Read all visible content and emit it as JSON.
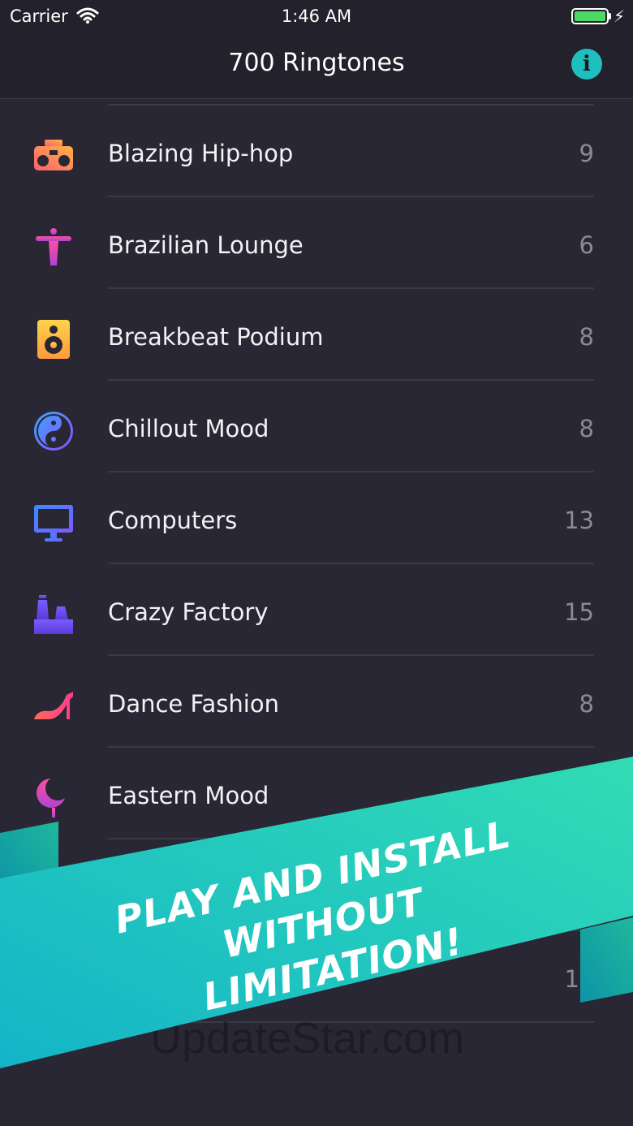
{
  "status_bar": {
    "carrier": "Carrier",
    "time": "1:46 AM",
    "wifi_icon": "wifi-icon",
    "battery_icon": "battery-icon",
    "charging_icon": "bolt-icon"
  },
  "nav": {
    "title": "700 Ringtones",
    "info_label": "i",
    "info_icon": "info-icon"
  },
  "categories": [
    {
      "label": "Blazing Hip-hop",
      "count": "9",
      "icon": "boombox-icon",
      "colors": [
        "#ff5f6d",
        "#ffb347"
      ]
    },
    {
      "label": "Brazilian Lounge",
      "count": "6",
      "icon": "christ-statue-icon",
      "colors": [
        "#ff4fa3",
        "#b043d1"
      ]
    },
    {
      "label": "Breakbeat Podium",
      "count": "8",
      "icon": "speaker-icon",
      "colors": [
        "#ffd24c",
        "#ff9a3c"
      ]
    },
    {
      "label": "Chillout Mood",
      "count": "8",
      "icon": "yin-yang-icon",
      "colors": [
        "#3ba6ff",
        "#8a4dff"
      ]
    },
    {
      "label": "Computers",
      "count": "13",
      "icon": "monitor-icon",
      "colors": [
        "#3b8bff",
        "#7a5cff"
      ]
    },
    {
      "label": "Crazy Factory",
      "count": "15",
      "icon": "factory-icon",
      "colors": [
        "#7b5cff",
        "#5a3bd6"
      ]
    },
    {
      "label": "Dance Fashion",
      "count": "8",
      "icon": "high-heel-icon",
      "colors": [
        "#ff6a5c",
        "#ff3d8b"
      ]
    },
    {
      "label": "Eastern Mood",
      "count": "",
      "icon": "crescent-icon",
      "colors": [
        "#ff4fa3",
        "#b043d1"
      ]
    }
  ],
  "partial_count": "1",
  "banner": {
    "line1": "PLAY AND INSTALL",
    "line2": "WITHOUT LIMITATION!",
    "colors": [
      "#14b4c8",
      "#32dcb4"
    ]
  },
  "watermark": "UpdateStar.com"
}
